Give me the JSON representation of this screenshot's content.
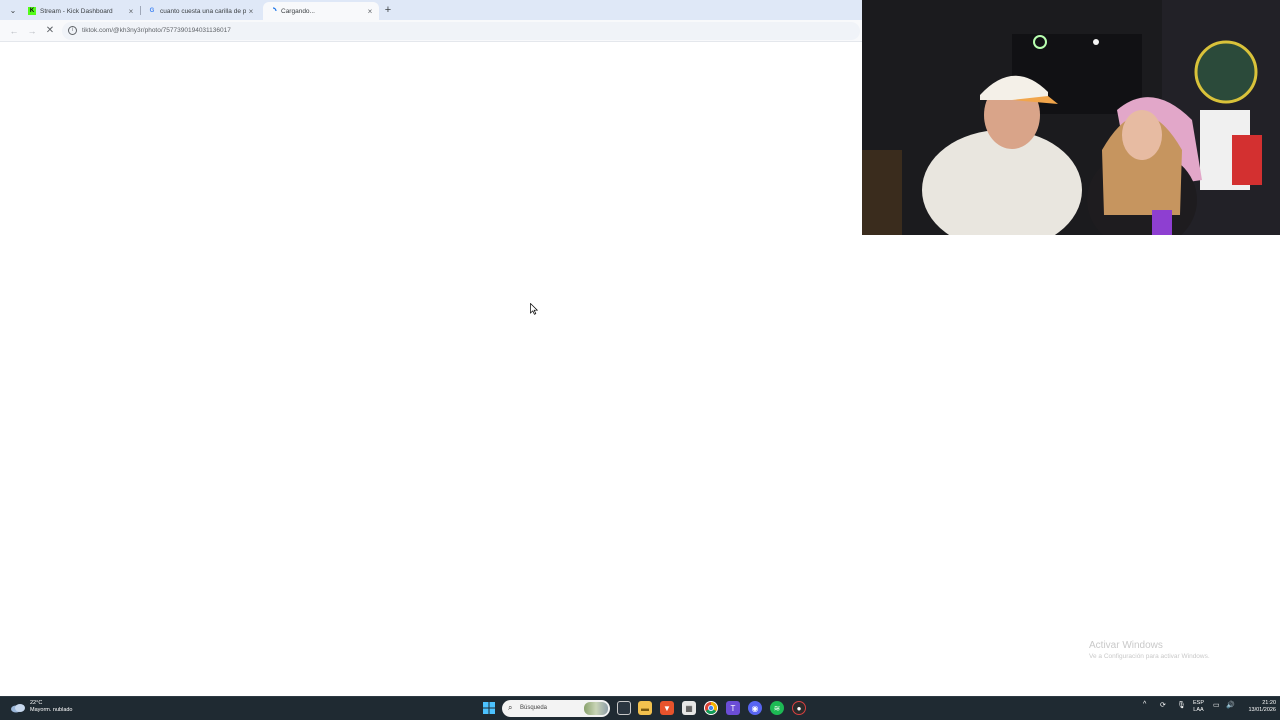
{
  "browser": {
    "tabs": [
      {
        "label": "Stream - Kick Dashboard",
        "favicon": "kick-icon",
        "active": false
      },
      {
        "label": "cuanto cuesta una carilla de po",
        "favicon": "google-icon",
        "active": false
      },
      {
        "label": "Cargando...",
        "favicon": "loading-icon",
        "active": true
      }
    ],
    "new_tab": "+",
    "url": "tiktok.com/@kh3ny3r/photo/7577390194031136017",
    "close_glyph": "×"
  },
  "watermark": {
    "line1": "Activar Windows",
    "line2": "Ve a Configuración para activar Windows."
  },
  "taskbar": {
    "weather_temp": "22°C",
    "weather_desc": "Mayorm. nublado",
    "search_placeholder": "Búsqueda",
    "lang_top": "ESP",
    "lang_bottom": "LAA",
    "time": "21:20",
    "date": "13/01/2026"
  },
  "colors": {
    "tabstrip": "#dfe8f7",
    "taskbar": "#1f2a32",
    "kick_green": "#53fc18",
    "spotify_green": "#1db954"
  }
}
